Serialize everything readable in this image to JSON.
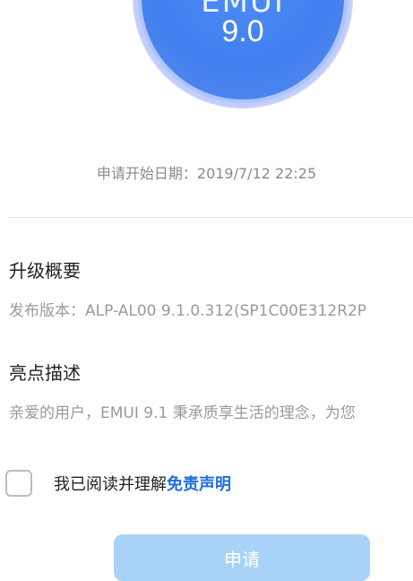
{
  "badge": {
    "name": "EMUI",
    "version": "9.0"
  },
  "apply_date": {
    "label": "申请开始日期：",
    "value": "2019/7/12 22:25"
  },
  "summary": {
    "title": "升级概要",
    "release_label": "发布版本：",
    "release_value": "ALP-AL00 9.1.0.312(SP1C00E312R2P"
  },
  "highlights": {
    "title": "亮点描述",
    "text": "亲爱的用户，EMUI 9.1 秉承质享生活的理念，为您"
  },
  "agreement": {
    "text": "我已阅读并理解",
    "link": "免责声明",
    "checked": false
  },
  "apply_button": {
    "label": "申请"
  },
  "colors": {
    "accent": "#1f6fe0",
    "button_disabled": "#a9d3f6",
    "badge": "#3f7ff0"
  }
}
